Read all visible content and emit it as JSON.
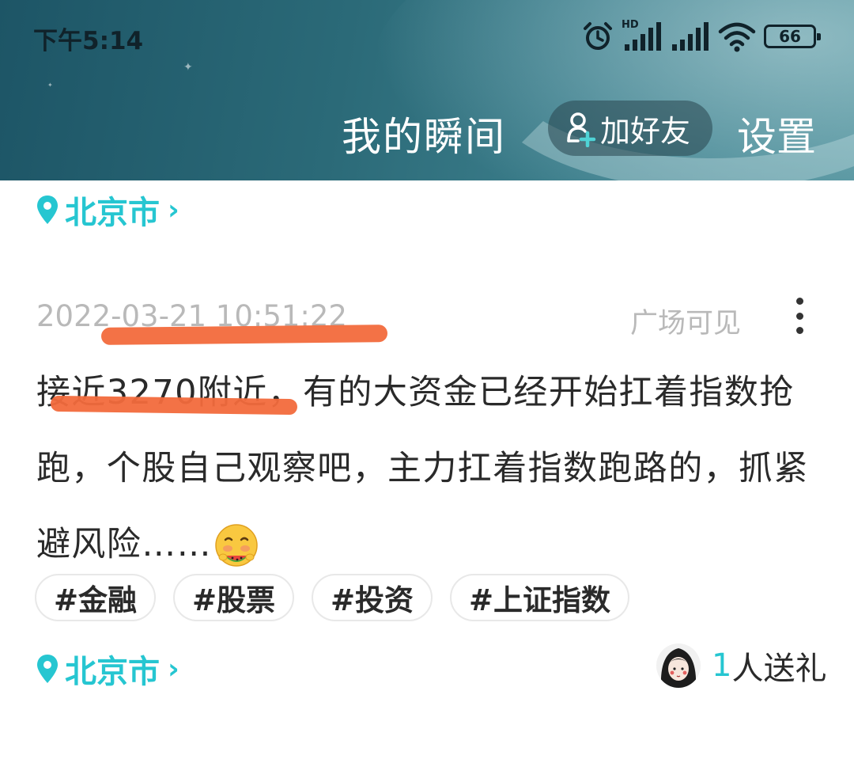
{
  "status_bar": {
    "time": "下午5:14",
    "network_label": "HD",
    "battery": "66"
  },
  "header": {
    "title": "我的瞬间",
    "add_friend": "加好友",
    "settings": "设置"
  },
  "posts": [
    {
      "location": "北京市"
    },
    {
      "timestamp": "2022-03-21 10:51:22",
      "visibility": "广场可见",
      "text": "接近3270附近，有的大资金已经开始扛着指数抢跑，个股自己观察吧，主力扛着指数跑路的，抓紧避风险……",
      "emoji": "watermelon-eating-face",
      "tags": [
        "#金融",
        "#股票",
        "#投资",
        "#上证指数"
      ],
      "location": "北京市",
      "gift": {
        "count": "1",
        "label": "人送礼"
      }
    }
  ],
  "colors": {
    "accent": "#26c6d1",
    "annotation": "#f26a3c",
    "header": "#2b6a78"
  }
}
